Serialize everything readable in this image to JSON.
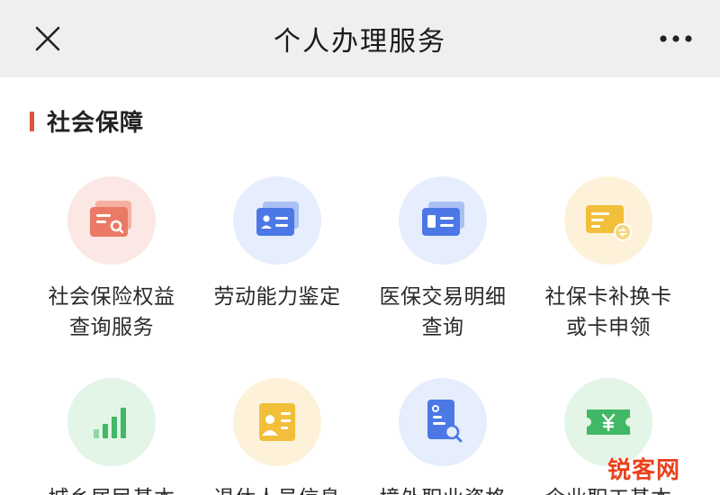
{
  "header": {
    "title": "个人办理服务"
  },
  "section": {
    "title": "社会保障"
  },
  "services": [
    {
      "label": "社会保险权益\n查询服务",
      "icon": "social-insurance-query-icon",
      "bg": "#fbe7e3",
      "fg": "#ea7a66"
    },
    {
      "label": "劳动能力鉴定",
      "icon": "labor-ability-id-card-icon",
      "bg": "#e6edfc",
      "fg": "#4c78e6"
    },
    {
      "label": "医保交易明细\n查询",
      "icon": "medical-insurance-card-icon",
      "bg": "#e6edfc",
      "fg": "#4c78e6"
    },
    {
      "label": "社保卡补换卡\n或卡申领",
      "icon": "social-security-card-replace-icon",
      "bg": "#fdf2d9",
      "fg": "#f2bf3a"
    },
    {
      "label": "城乡居民基本",
      "icon": "bar-chart-icon",
      "bg": "#e2f5e6",
      "fg": "#41b866"
    },
    {
      "label": "退休人员信息",
      "icon": "retiree-profile-icon",
      "bg": "#fdf2d9",
      "fg": "#f2bf3a"
    },
    {
      "label": "境外职业资格",
      "icon": "document-search-icon",
      "bg": "#e6edfc",
      "fg": "#4c78e6"
    },
    {
      "label": "企业职工基本",
      "icon": "yen-ticket-icon",
      "bg": "#e2f5e6",
      "fg": "#41b866"
    }
  ],
  "watermark": "锐客网"
}
